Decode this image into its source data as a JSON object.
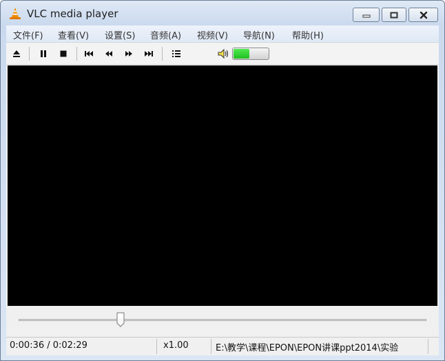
{
  "window": {
    "title": "VLC media player",
    "icon": "vlc-cone-icon",
    "controls": [
      "minimize-icon",
      "maximize-icon",
      "close-icon"
    ]
  },
  "menu": {
    "items": [
      "文件(F)",
      "查看(V)",
      "设置(S)",
      "音频(A)",
      "视频(V)",
      "导航(N)",
      "帮助(H)"
    ]
  },
  "toolbar": {
    "buttons": [
      "eject-icon",
      "pause-icon",
      "stop-icon",
      "skip-back-icon",
      "rewind-icon",
      "fast-forward-icon",
      "skip-forward-icon",
      "playlist-icon"
    ],
    "volume": {
      "icon": "speaker-icon",
      "level": 0.45,
      "fill_color": "#22c022"
    }
  },
  "video": {
    "background": "#000000"
  },
  "seek": {
    "position": 0.25
  },
  "status": {
    "time": "0:00:36 / 0:02:29",
    "speed": "x1.00",
    "file_path": "E:\\教学\\课程\\EPON\\EPON讲课ppt2014\\实验"
  }
}
